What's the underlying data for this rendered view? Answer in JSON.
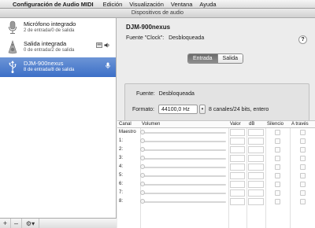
{
  "menubar": {
    "app_name": "Configuración de Audio MIDI",
    "items": [
      "Edición",
      "Visualización",
      "Ventana",
      "Ayuda"
    ]
  },
  "window": {
    "title": "Dispositivos de audio"
  },
  "sidebar": {
    "devices": [
      {
        "name": "Micrófono integrado",
        "sub": "2 de entrada/0 de salida",
        "icon": "microphone-icon",
        "selected": false
      },
      {
        "name": "Salida integrada",
        "sub": "0 de entrada/2 de salida",
        "icon": "speaker-icon",
        "selected": false
      },
      {
        "name": "DJM-900nexus",
        "sub": "8 de entrada/8 de salida",
        "icon": "usb-icon",
        "selected": true
      }
    ],
    "footer": {
      "add": "+",
      "remove": "–",
      "gear": "⚙▾"
    }
  },
  "detail": {
    "device_name": "DJM-900nexus",
    "clock_label": "Fuente \"Clock\":",
    "clock_value": "Desbloqueada",
    "help": "?",
    "tabs": [
      "Entrada",
      "Salida"
    ],
    "active_tab": "Entrada",
    "source_label": "Fuente:",
    "source_value": "Desbloqueada",
    "format_label": "Formato:",
    "format_value": "44100,0 Hz",
    "stepper": "▾",
    "format_desc": "8 canales/24 bits, entero"
  },
  "table": {
    "headers": {
      "canal": "Canal",
      "volumen": "Volumen",
      "valor": "Valor",
      "db": "dB",
      "silencio": "Silencio",
      "a_traves": "A través"
    },
    "rows": [
      "Maestro",
      "1:",
      "2:",
      "3:",
      "4:",
      "5:",
      "6:",
      "7:",
      "8:"
    ]
  }
}
